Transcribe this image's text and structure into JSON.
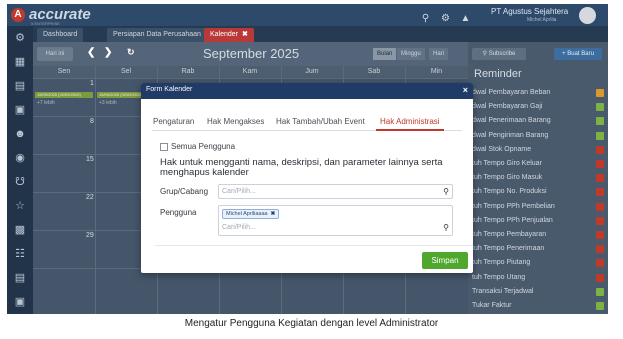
{
  "app": {
    "logo_text": "accurate",
    "logo_sub": "5 ENTERPRISE",
    "company_name": "PT Agustus Sejahtera",
    "company_sub": "Michel Aprilia"
  },
  "tabs": [
    {
      "label": "Dashboard"
    },
    {
      "label": "Persiapan Data Perusahaan"
    },
    {
      "label": "Kalender",
      "close": "✖"
    }
  ],
  "calendar": {
    "today_label": "Hari ini",
    "month_title": "September 2025",
    "views": [
      "Bulan",
      "Minggu",
      "Hari"
    ],
    "weekdays": [
      "Sen",
      "Sel",
      "Rab",
      "Kam",
      "Jum",
      "Sab",
      "Min"
    ],
    "day_numbers": [
      "1",
      "8",
      "15",
      "22",
      "29"
    ],
    "events": [
      "15/09/2025 (32/09/2025)",
      "15/09/2025 (32/09/2025)"
    ],
    "more_labels": [
      "+7 lebih",
      "+3 lebih"
    ]
  },
  "right_panel": {
    "subscribe_label": "Subscribe",
    "new_label": "Buat Baru",
    "reminder_title": "Reminder",
    "reminders": [
      {
        "label": "dwal Pembayaran Beban",
        "color": "#d89a2b"
      },
      {
        "label": "dwal Pembayaran Gaji",
        "color": "#7cb342"
      },
      {
        "label": "dwal Penerimaan Barang",
        "color": "#7cb342"
      },
      {
        "label": "dwal Pengiriman Barang",
        "color": "#7cb342"
      },
      {
        "label": "dwal Stok Opname",
        "color": "#c0392b"
      },
      {
        "label": "tuh Tempo Giro Keluar",
        "color": "#c0392b"
      },
      {
        "label": "tuh Tempo Giro Masuk",
        "color": "#c0392b"
      },
      {
        "label": "tuh Tempo No. Produksi",
        "color": "#c0392b"
      },
      {
        "label": "tuh Tempo PPh Pembelian",
        "color": "#c0392b"
      },
      {
        "label": "tuh Tempo PPh Penjualan",
        "color": "#c0392b"
      },
      {
        "label": "tuh Tempo Pembayaran",
        "color": "#c0392b"
      },
      {
        "label": "tuh Tempo Penerimaan",
        "color": "#c0392b"
      },
      {
        "label": "tuh Tempo Piutang",
        "color": "#c0392b"
      },
      {
        "label": "tuh Tempo Utang",
        "color": "#c0392b"
      },
      {
        "label": "Transaksi Terjadwal",
        "color": "#7cb342"
      },
      {
        "label": "Tukar Faktur",
        "color": "#7cb342"
      }
    ]
  },
  "modal": {
    "title": "Form Kalender",
    "close": "×",
    "tabs": [
      "Pengaturan",
      "Hak Mengakses",
      "Hak Tambah/Ubah Event",
      "Hak Administrasi"
    ],
    "active_tab_index": 3,
    "all_users_label": "Semua Pengguna",
    "all_users_checked": false,
    "description": "Hak untuk mengganti nama, deskripsi, dan parameter lainnya serta menghapus kalender",
    "branch_label": "Grup/Cabang",
    "branch_placeholder": "Cari/Pilih...",
    "user_label": "Pengguna",
    "user_chip": "Michel Apriliaaaa",
    "user_chip_remove": "✖",
    "user_placeholder": "Cari/Pilih...",
    "save_label": "Simpan"
  },
  "caption": "Mengatur Pengguna Kegiatan dengan level Administrator"
}
